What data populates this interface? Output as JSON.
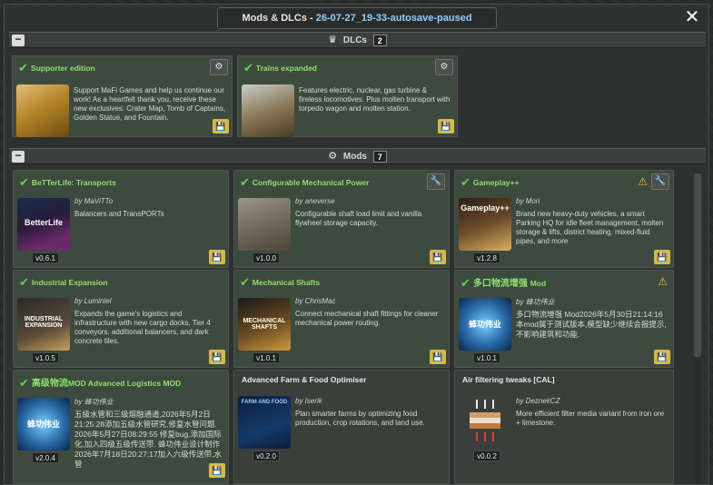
{
  "window": {
    "title_prefix": "Mods & DLCs - ",
    "title_file": "26-07-27_19-33-autosave-paused",
    "close_glyph": "✕"
  },
  "dlcs": {
    "header": "DLCs",
    "count": "2",
    "items": [
      {
        "title": "Supporter edition",
        "desc": "Support MaFi Games and help us continue our work! As a heartfelt thank you, receive these new exclusives: Crater Map, Tomb of Captains, Golden Statue, and Fountain."
      },
      {
        "title": "Trains expanded",
        "desc": "Features electric, nuclear, gas turbine & fireless locomotives. Plus molten transport with torpedo wagon and molten station."
      }
    ]
  },
  "mods": {
    "header": "Mods",
    "count": "7",
    "items": [
      {
        "title": "BeTTerLife: Transports",
        "author": "by MaViTTo",
        "desc": "Balancers and TransPORTs",
        "version": "v0.6.1",
        "icon_text": "BetterLife"
      },
      {
        "title": "Configurable Mechanical Power",
        "author": "by aneverse",
        "desc": "Configurable shaft load limit and vanilla flywheel storage capacity.",
        "version": "v1.0.0",
        "icon_text": ""
      },
      {
        "title": "Gameplay++",
        "author": "by Mori",
        "desc": "Brand new heavy-duty vehicles, a smart Parking HQ for idle fleet management, molten storage & lifts, district heating, mixed-fluid pipes, and more",
        "version": "v1.2.8",
        "icon_text": "Gameplay++"
      },
      {
        "title": "Industrial Expansion",
        "author": "by Luminiel",
        "desc": "Expands the game's logistics and infrastructure with new cargo docks, Tier 4 conveyors, additional balancers, and dark concrete tiles.",
        "version": "v1.0.5",
        "icon_text": "INDUSTRIAL EXPANSION"
      },
      {
        "title": "Mechanical Shafts",
        "author": "by ChrisMac",
        "desc": "Connect mechanical shaft fittings for cleaner mechanical power routing.",
        "version": "v1.0.1",
        "icon_text": "MECHANICAL SHAFTS"
      },
      {
        "title": "多口物流增强",
        "title_suffix": "Mod",
        "author": "by 蜂功伟业",
        "desc": "多口物流增强 Mod2026年5月30日21:14:16 本mod属于测试版本,模型缺少继续会报提示,不影响建筑和功能.",
        "version": "v1.0.1",
        "icon_text": "蜂功伟业"
      },
      {
        "title": "高级物流",
        "title_suffix": "MOD Advanced Logistics MOD",
        "author": "by 蜂功伟业",
        "desc": "五级水管和三级熔融通道,2026年5月2日21:25:28添加五级水管研究,修复水管问题. 2026年5月27日08:29:55 修复bug,添加国际化,加入四级五级传送带. 蜂功伟业设计制作 2026年7月18日20:27:17加入六级传送带,水管",
        "version": "v2.0.4",
        "icon_text": "蜂功伟业"
      },
      {
        "title": "Advanced Farm & Food Optimiser",
        "author": "by Iserik",
        "desc": "Plan smarter farms by optimizing food production, crop rotations, and land use.",
        "version": "v0.2.0",
        "icon_text": "FARM AND FOOD"
      },
      {
        "title": "Air filtering tweaks [CAL]",
        "author": "by DeznekCZ",
        "desc": "More efficient filter media variant from iron ore + limestone.",
        "version": "v0.0.2",
        "icon_text": ""
      }
    ]
  },
  "icons": {
    "check": "✔",
    "warning": "⚠",
    "wrench": "🔧",
    "settings": "⚙",
    "save": "💾",
    "dlc_header_icon": "♛",
    "mods_header_icon": "⚙"
  }
}
